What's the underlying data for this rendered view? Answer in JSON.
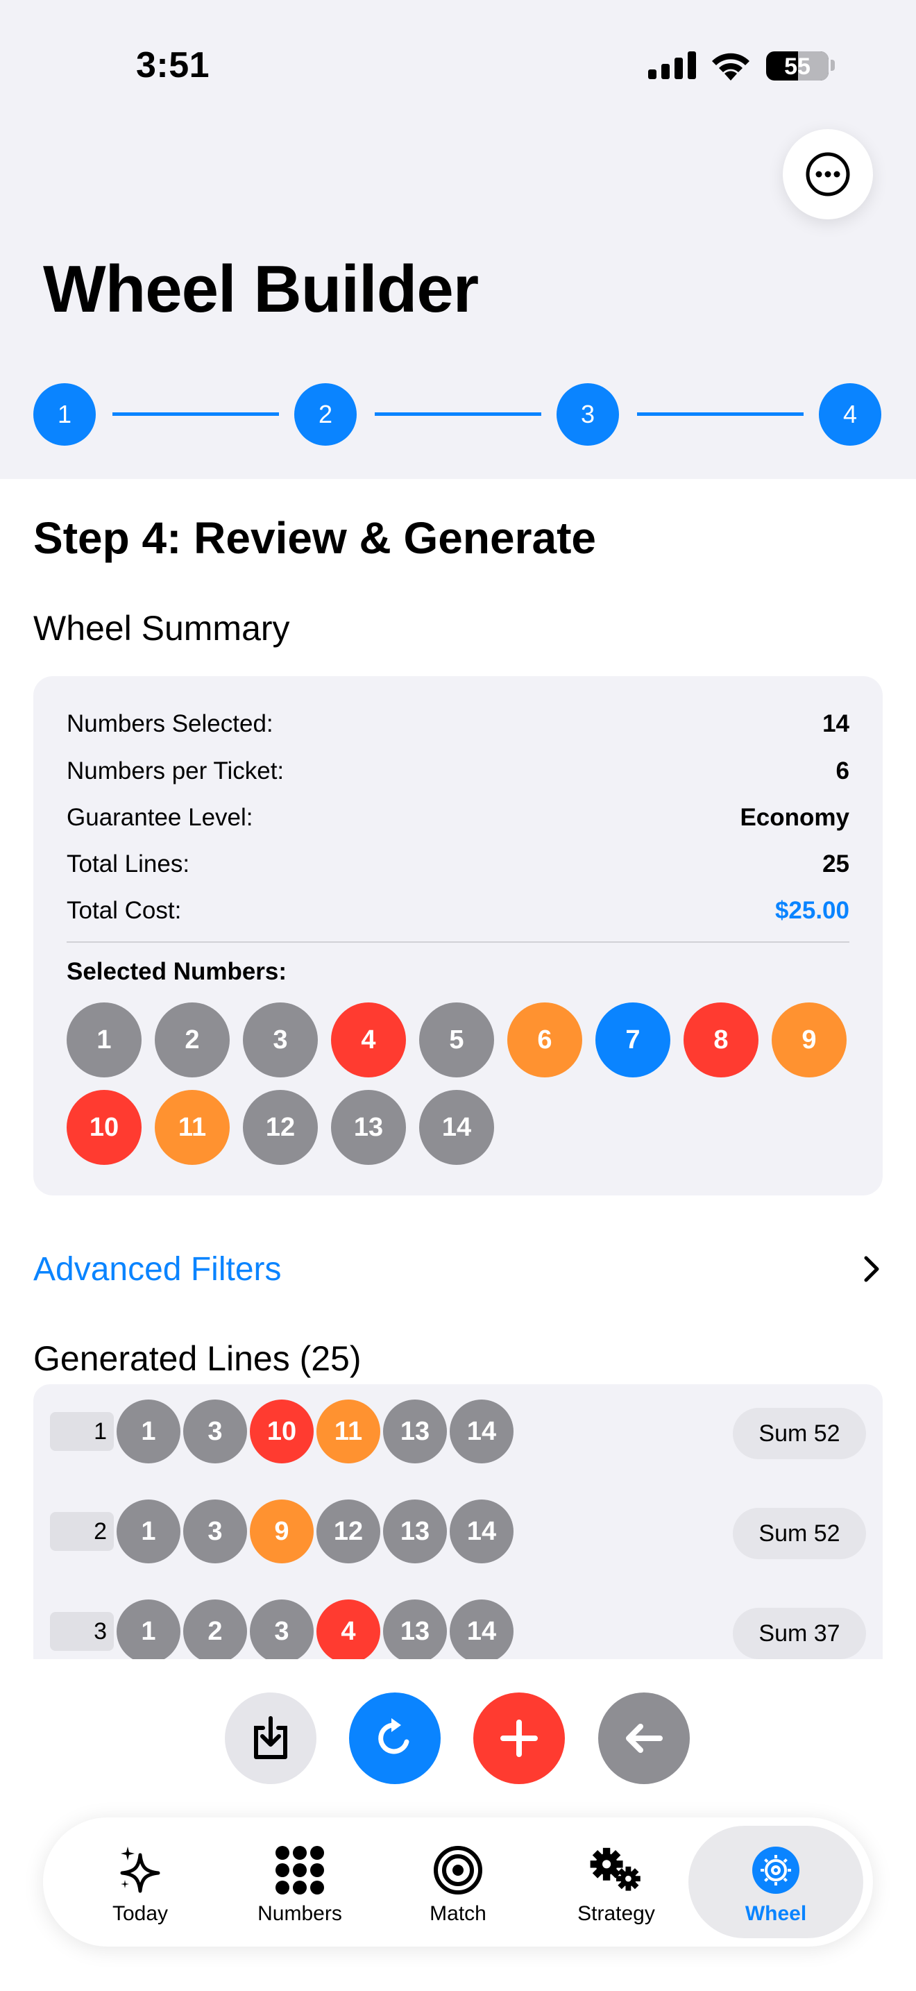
{
  "status_bar": {
    "time": "3:51",
    "battery": "55"
  },
  "header": {
    "title": "Wheel Builder"
  },
  "stepper": {
    "steps": [
      "1",
      "2",
      "3",
      "4"
    ]
  },
  "main": {
    "step_title": "Step 4: Review & Generate",
    "summary_title": "Wheel Summary",
    "summary_rows": [
      {
        "label": "Numbers Selected:",
        "value": "14"
      },
      {
        "label": "Numbers per Ticket:",
        "value": "6"
      },
      {
        "label": "Guarantee Level:",
        "value": "Economy"
      },
      {
        "label": "Total Lines:",
        "value": "25"
      },
      {
        "label": "Total Cost:",
        "value": "$25.00"
      }
    ],
    "selected_label": "Selected Numbers:",
    "selected_numbers": [
      {
        "n": "1",
        "color": "gray"
      },
      {
        "n": "2",
        "color": "gray"
      },
      {
        "n": "3",
        "color": "gray"
      },
      {
        "n": "4",
        "color": "red"
      },
      {
        "n": "5",
        "color": "gray"
      },
      {
        "n": "6",
        "color": "orange"
      },
      {
        "n": "7",
        "color": "blue"
      },
      {
        "n": "8",
        "color": "red"
      },
      {
        "n": "9",
        "color": "orange"
      },
      {
        "n": "10",
        "color": "red"
      },
      {
        "n": "11",
        "color": "orange"
      },
      {
        "n": "12",
        "color": "gray"
      },
      {
        "n": "13",
        "color": "gray"
      },
      {
        "n": "14",
        "color": "gray"
      }
    ],
    "advanced_filters": "Advanced Filters",
    "generated_title": "Generated Lines (25)",
    "lines": [
      {
        "num": "1",
        "sum": "Sum 52",
        "balls": [
          {
            "n": "1",
            "color": "gray"
          },
          {
            "n": "3",
            "color": "gray"
          },
          {
            "n": "10",
            "color": "red"
          },
          {
            "n": "11",
            "color": "orange"
          },
          {
            "n": "13",
            "color": "gray"
          },
          {
            "n": "14",
            "color": "gray"
          }
        ]
      },
      {
        "num": "2",
        "sum": "Sum 52",
        "balls": [
          {
            "n": "1",
            "color": "gray"
          },
          {
            "n": "3",
            "color": "gray"
          },
          {
            "n": "9",
            "color": "orange"
          },
          {
            "n": "12",
            "color": "gray"
          },
          {
            "n": "13",
            "color": "gray"
          },
          {
            "n": "14",
            "color": "gray"
          }
        ]
      },
      {
        "num": "3",
        "sum": "Sum 37",
        "balls": [
          {
            "n": "1",
            "color": "gray"
          },
          {
            "n": "2",
            "color": "gray"
          },
          {
            "n": "3",
            "color": "gray"
          },
          {
            "n": "4",
            "color": "red"
          },
          {
            "n": "13",
            "color": "gray"
          },
          {
            "n": "14",
            "color": "gray"
          }
        ]
      }
    ]
  },
  "actions": [
    "download-icon",
    "refresh-icon",
    "add-icon",
    "back-arrow-icon"
  ],
  "tabs": [
    {
      "label": "Today",
      "icon": "sparkles-icon"
    },
    {
      "label": "Numbers",
      "icon": "grid-dots-icon"
    },
    {
      "label": "Match",
      "icon": "target-icon"
    },
    {
      "label": "Strategy",
      "icon": "gears-icon"
    },
    {
      "label": "Wheel",
      "icon": "wheel-gear-icon",
      "active": true
    }
  ],
  "colors": {
    "accent": "#0a84ff",
    "gray": "#8e8e93",
    "red": "#ff3b30",
    "orange": "#ff9230",
    "blue": "#0a84ff"
  }
}
